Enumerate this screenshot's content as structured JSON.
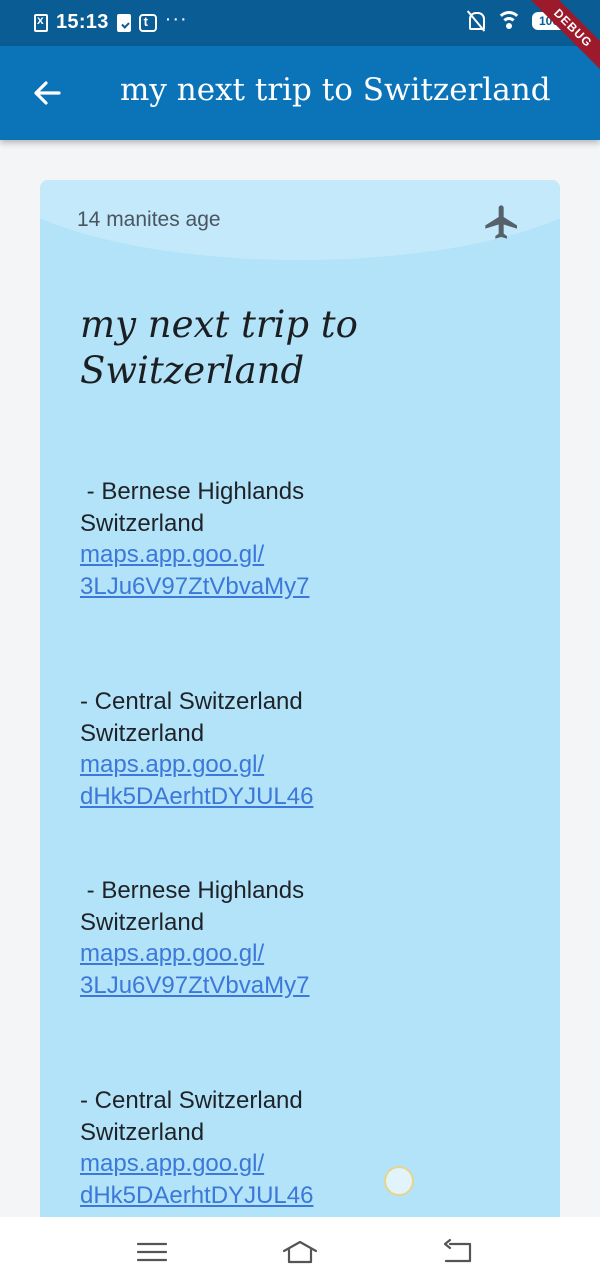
{
  "status_bar": {
    "time": "15:13",
    "dots": "···",
    "battery": "100"
  },
  "debug_banner": "DEBUG",
  "app_bar": {
    "title": "my next trip to Switzerland",
    "back_icon": "arrow-left-icon"
  },
  "card": {
    "background_color": "#b3e3f8",
    "timestamp": "14 manites age",
    "category_icon": "airplane-icon",
    "title_line1": "my next trip to",
    "title_line2": "Switzerland",
    "entries": [
      {
        "place": " - Bernese Highlands",
        "country": "Switzerland",
        "link_line1": "maps.app.goo.gl/",
        "link_line2": "3LJu6V97ZtVbvaMy7"
      },
      {
        "place": "- Central Switzerland",
        "country": "Switzerland",
        "link_line1": "maps.app.goo.gl/",
        "link_line2": "dHk5DAerhtDYJUL46"
      },
      {
        "place": " - Bernese Highlands",
        "country": "Switzerland",
        "link_line1": "maps.app.goo.gl/",
        "link_line2": "3LJu6V97ZtVbvaMy7"
      },
      {
        "place": "- Central Switzerland",
        "country": "Switzerland",
        "link_line1": "maps.app.goo.gl/",
        "link_line2": "dHk5DAerhtDYJUL46"
      }
    ]
  },
  "nav_bar": {
    "icons": [
      "menu-icon",
      "home-icon",
      "back-icon"
    ]
  },
  "colors": {
    "status_bar": "#0a5c94",
    "app_bar": "#0b73b8",
    "link": "#3b78d9"
  }
}
